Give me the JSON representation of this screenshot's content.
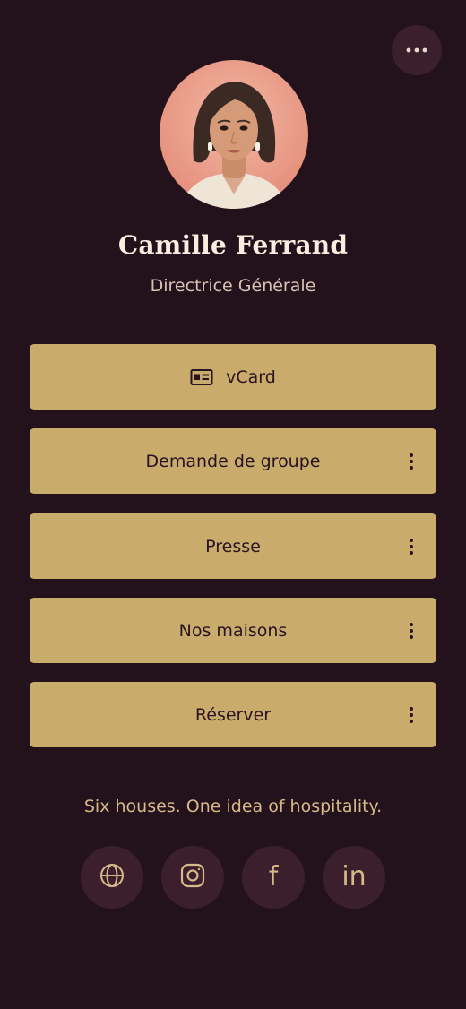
{
  "profile": {
    "name": "Camille Ferrand",
    "role": "Directrice Générale"
  },
  "header": {
    "menu_icon": "more-horizontal-icon"
  },
  "links": [
    {
      "label": "vCard",
      "icon": "id-card-icon",
      "has_menu": false
    },
    {
      "label": "Demande de groupe",
      "has_menu": true
    },
    {
      "label": "Presse",
      "has_menu": true
    },
    {
      "label": "Nos maisons",
      "has_menu": true
    },
    {
      "label": "Réserver",
      "has_menu": true
    }
  ],
  "tagline": "Six houses. One idea of hospitality.",
  "social": [
    {
      "icon": "globe-icon"
    },
    {
      "icon": "instagram-icon"
    },
    {
      "icon": "facebook-icon",
      "glyph": "f"
    },
    {
      "icon": "linkedin-icon",
      "glyph": "in"
    }
  ],
  "colors": {
    "background": "#23111c",
    "button": "#c9ab6c",
    "button_text": "#2a1320",
    "circle_bg": "#3b1f2c",
    "accent": "#d6b98a",
    "name": "#fbeee0"
  }
}
